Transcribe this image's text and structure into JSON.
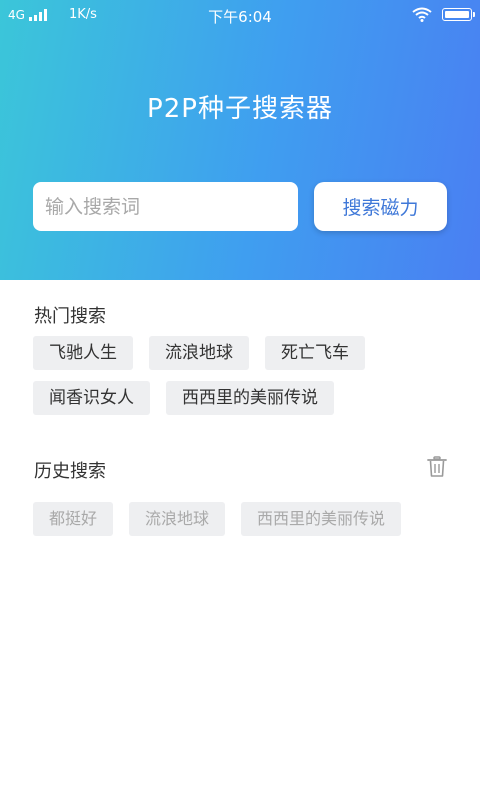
{
  "status_bar": {
    "network": "4G",
    "speed": "1K/s",
    "time": "下午6:04",
    "icons": [
      "signal-icon",
      "wifi-icon",
      "battery-icon"
    ]
  },
  "app_title": "P2P种子搜索器",
  "search": {
    "placeholder": "输入搜索词",
    "value": "",
    "button_label": "搜索磁力"
  },
  "hot_search": {
    "title": "热门搜索",
    "tags": [
      "飞驰人生",
      "流浪地球",
      "死亡飞车",
      "闻香识女人",
      "西西里的美丽传说"
    ]
  },
  "history_search": {
    "title": "历史搜索",
    "clear_icon": "trash-icon",
    "tags": [
      "都挺好",
      "流浪地球",
      "西西里的美丽传说"
    ]
  },
  "colors": {
    "header_gradient_start": "#3bc6d9",
    "header_gradient_end": "#4a7ff2",
    "button_text": "#3f78d8",
    "tag_background": "#eeeff1",
    "history_tag_text": "#a9a9a9"
  }
}
